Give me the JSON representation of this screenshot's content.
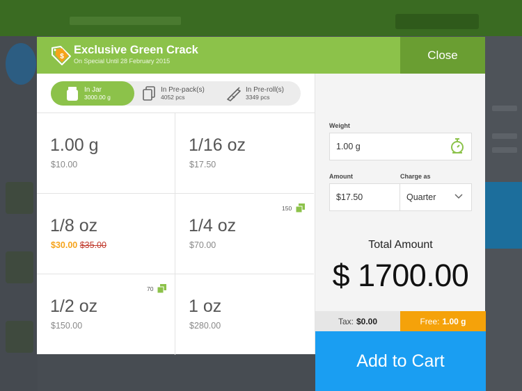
{
  "product": {
    "title": "Exclusive Green Crack",
    "subtitle": "On Special Until 28 February 2015"
  },
  "header": {
    "close_label": "Close"
  },
  "package_types": [
    {
      "label": "In Jar",
      "detail": "3000.00 g",
      "icon": "jar-icon",
      "active": true
    },
    {
      "label": "In Pre-pack(s)",
      "detail": "4052 pcs",
      "icon": "pre-pack-icon",
      "active": false
    },
    {
      "label": "In Pre-roll(s)",
      "detail": "3349 pcs",
      "icon": "pre-roll-icon",
      "active": false
    }
  ],
  "weights": [
    {
      "weight": "1.00 g",
      "price": "$10.00"
    },
    {
      "weight": "1/16 oz",
      "price": "$17.50"
    },
    {
      "weight": "1/8 oz",
      "price_sale": "$30.00",
      "price_old": "$35.00"
    },
    {
      "weight": "1/4 oz",
      "price": "$70.00",
      "stock_badge": "150"
    },
    {
      "weight": "1/2 oz",
      "price": "$150.00",
      "stock_badge": "70"
    },
    {
      "weight": "1 oz",
      "price": "$280.00"
    }
  ],
  "form": {
    "weight_label": "Weight",
    "weight_value": "1.00 g",
    "amount_label": "Amount",
    "amount_value": "$17.50",
    "charge_label": "Charge as",
    "charge_value": "Quarter"
  },
  "totals": {
    "total_label": "Total Amount",
    "total_value": "$ 1700.00",
    "tax_label": "Tax:",
    "tax_value": "$0.00",
    "free_label": "Free:",
    "free_value": "1.00 g"
  },
  "actions": {
    "add_to_cart": "Add to Cart"
  },
  "colors": {
    "brand_green": "#8cc24a",
    "close_green": "#6a9e32",
    "sale_orange": "#f5a31b",
    "cart_blue": "#1a9ef2"
  }
}
